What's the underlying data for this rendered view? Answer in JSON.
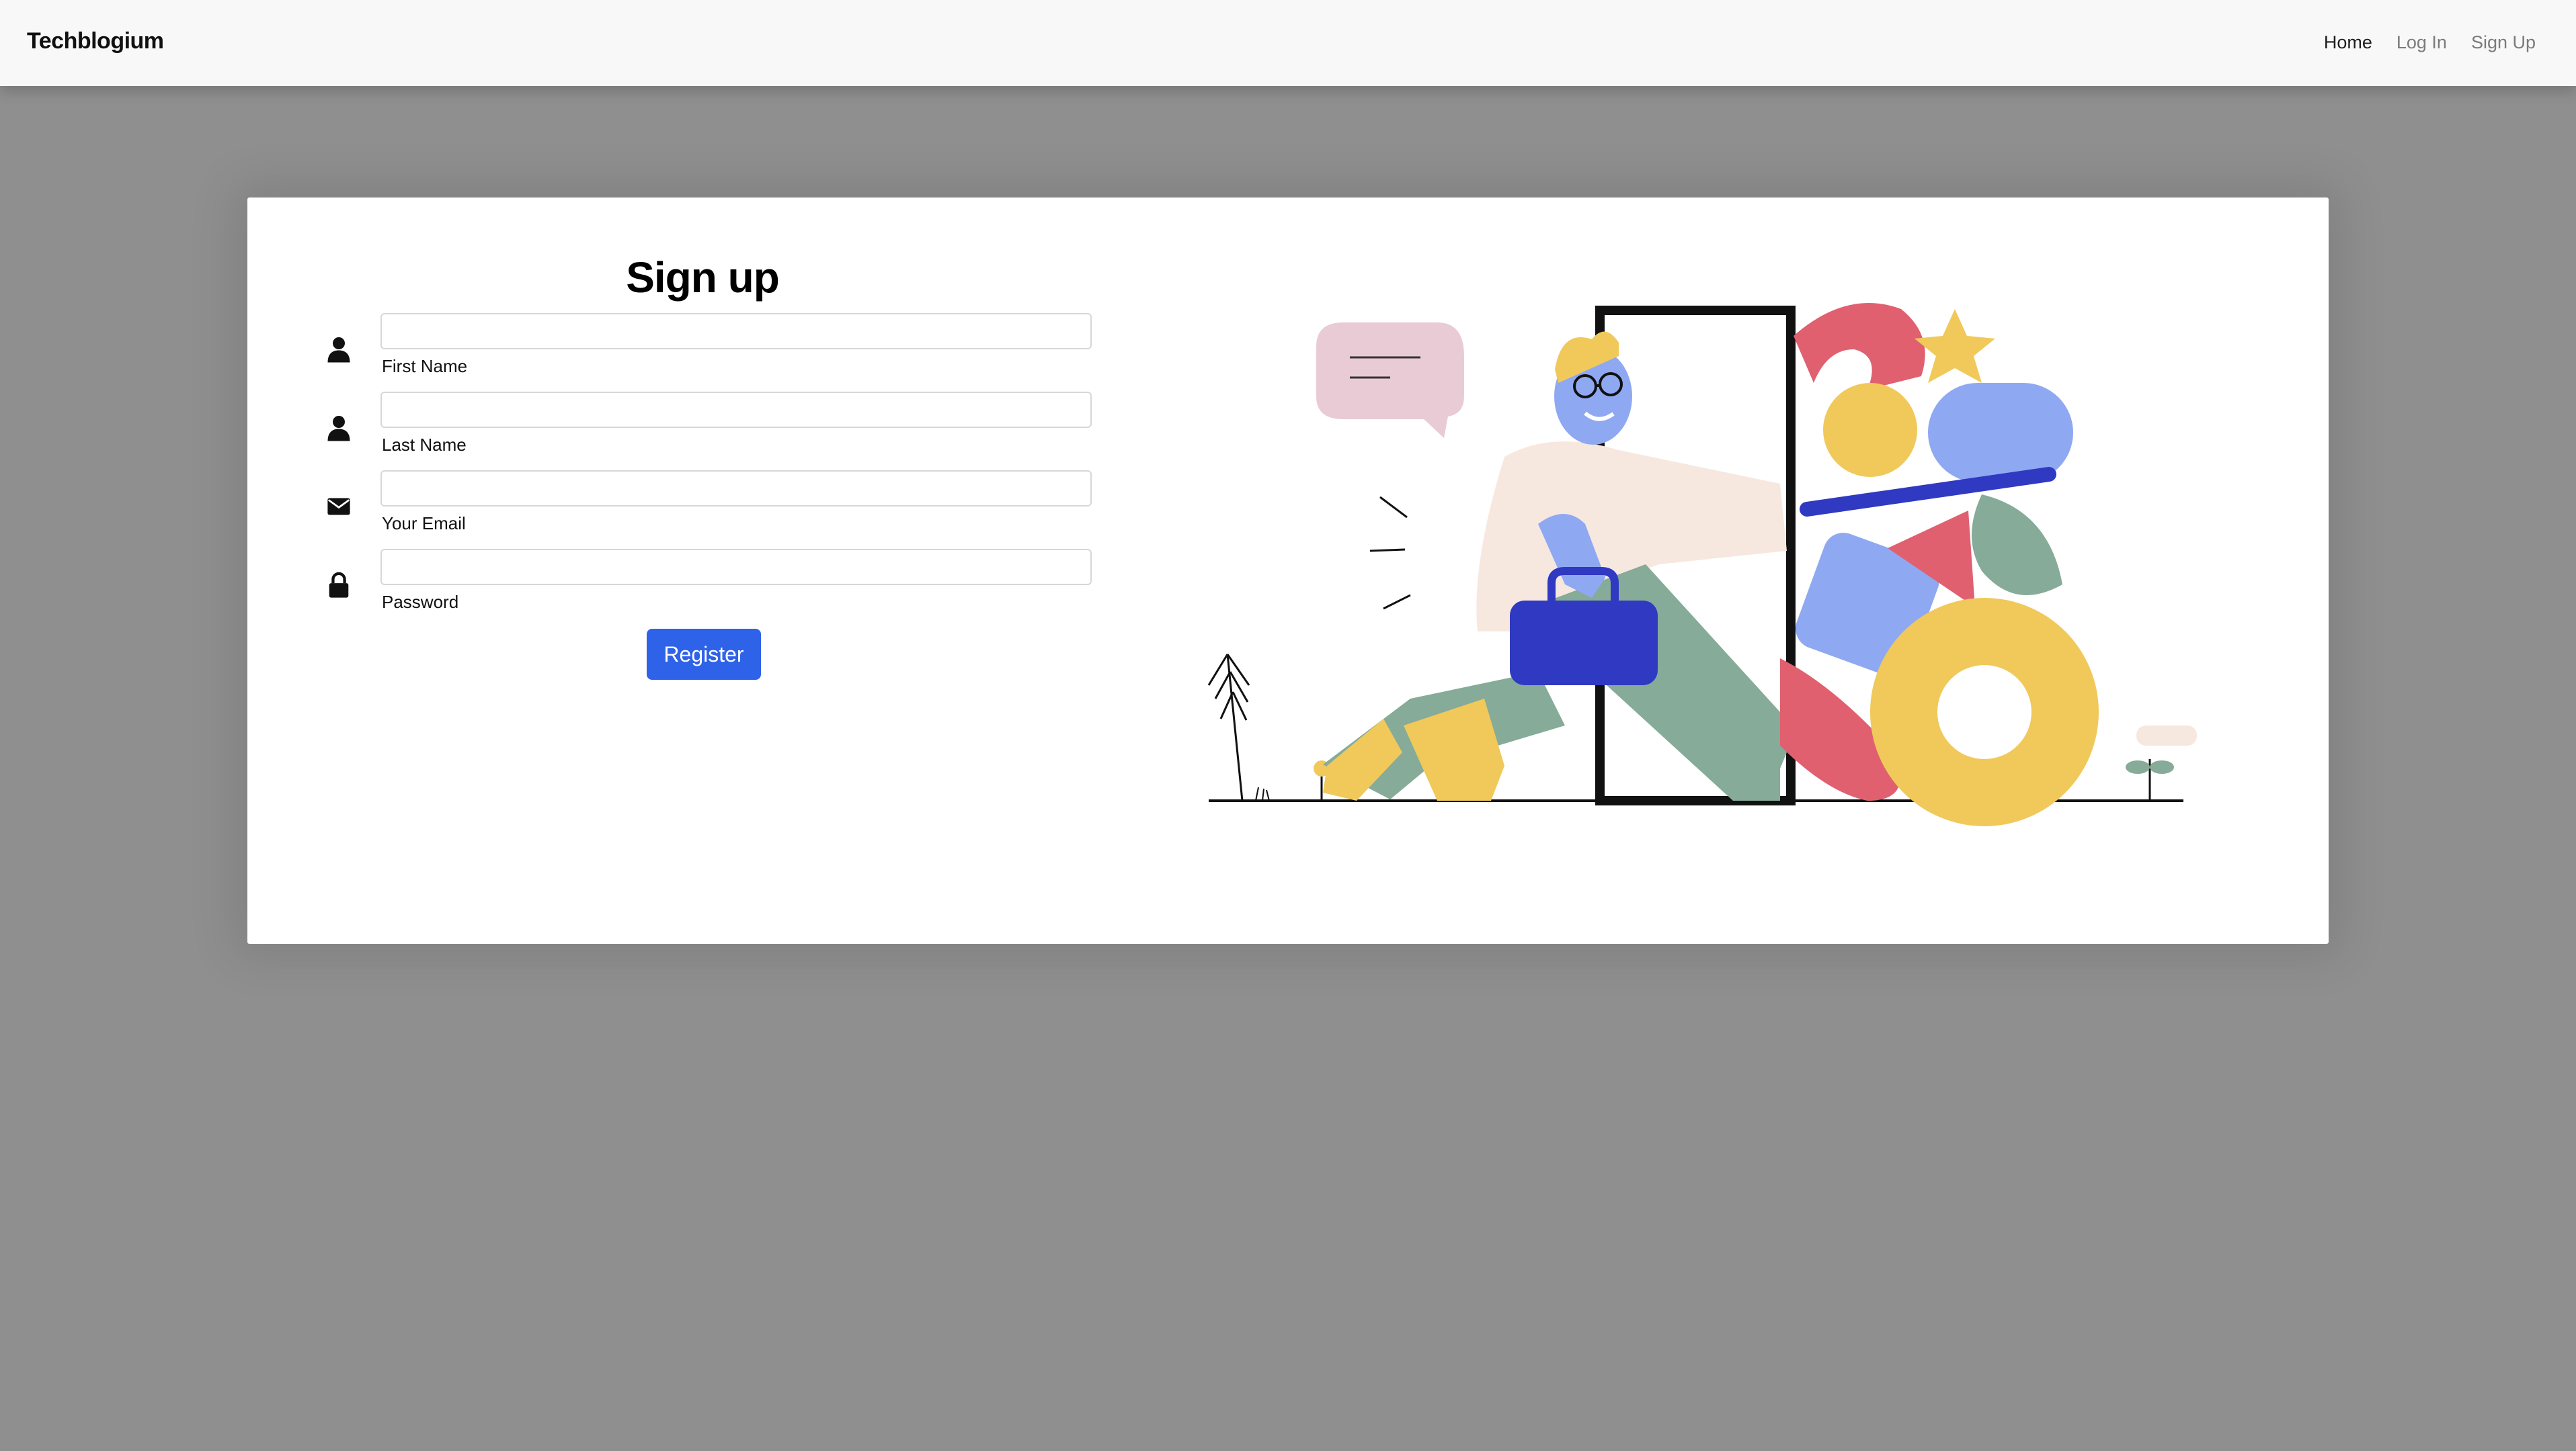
{
  "navbar": {
    "brand": "Techblogium",
    "links": [
      "Home",
      "Log In",
      "Sign Up"
    ]
  },
  "form": {
    "title": "Sign up",
    "fields": [
      {
        "label": "First Name",
        "value": "",
        "icon": "user-icon"
      },
      {
        "label": "Last Name",
        "value": "",
        "icon": "user-icon"
      },
      {
        "label": "Your Email",
        "value": "",
        "icon": "envelope-icon"
      },
      {
        "label": "Password",
        "value": "",
        "icon": "lock-icon"
      }
    ],
    "submit_label": "Register"
  },
  "colors": {
    "accent": "#2e62e8",
    "backdrop": "#8f8f8f",
    "navbar": "#f8f8f8"
  },
  "illustration": {
    "subject": "person-walking-through-door-with-briefcase"
  }
}
